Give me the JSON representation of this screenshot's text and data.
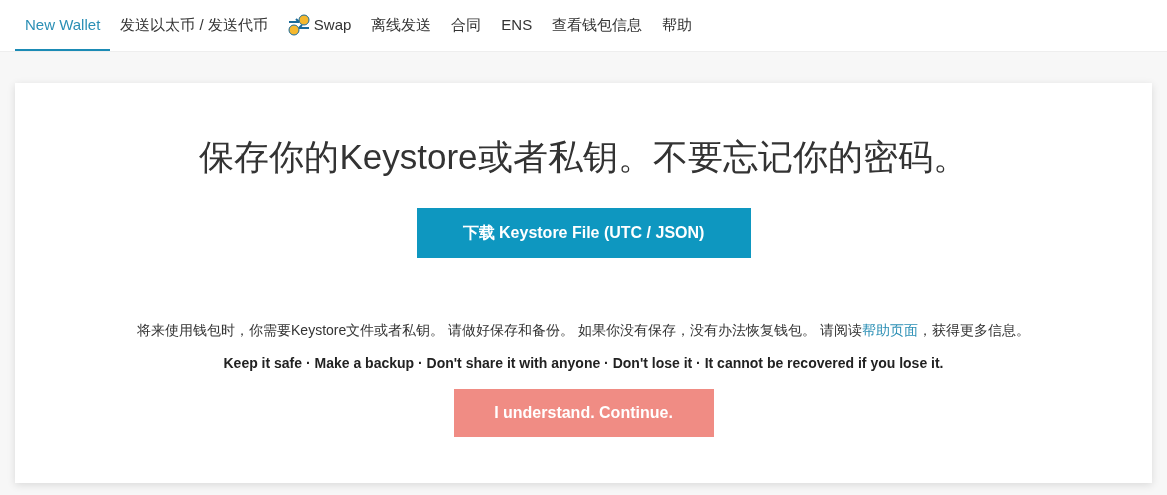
{
  "tabs": [
    {
      "label": "New Wallet",
      "selected": true
    },
    {
      "label": "发送以太币 / 发送代币",
      "selected": false
    },
    {
      "label": "Swap",
      "selected": false,
      "kind": "icon"
    },
    {
      "label": "离线发送",
      "selected": false
    },
    {
      "label": "合同",
      "selected": false
    },
    {
      "label": "ENS",
      "selected": false
    },
    {
      "label": "查看钱包信息",
      "selected": false
    },
    {
      "label": "帮助",
      "selected": false
    }
  ],
  "card": {
    "heading": "保存你的Keystore或者私钥。不要忘记你的密码。",
    "download_button": "下载 Keystore File (UTC / JSON)",
    "notice": {
      "before": "将来使用钱包时，你需要Keystore文件或者私钥。 请做好保存和备份。 如果你没有保存，没有办法恢复钱包。 请阅读",
      "link": "帮助页面",
      "after": "，获得更多信息。"
    },
    "tips": "Keep it safe · Make a backup · Don't share it with anyone · Don't lose it · It cannot be recovered if you lose it.",
    "continue_button": {
      "label": "I understand. Continue.",
      "disabled": true
    }
  }
}
